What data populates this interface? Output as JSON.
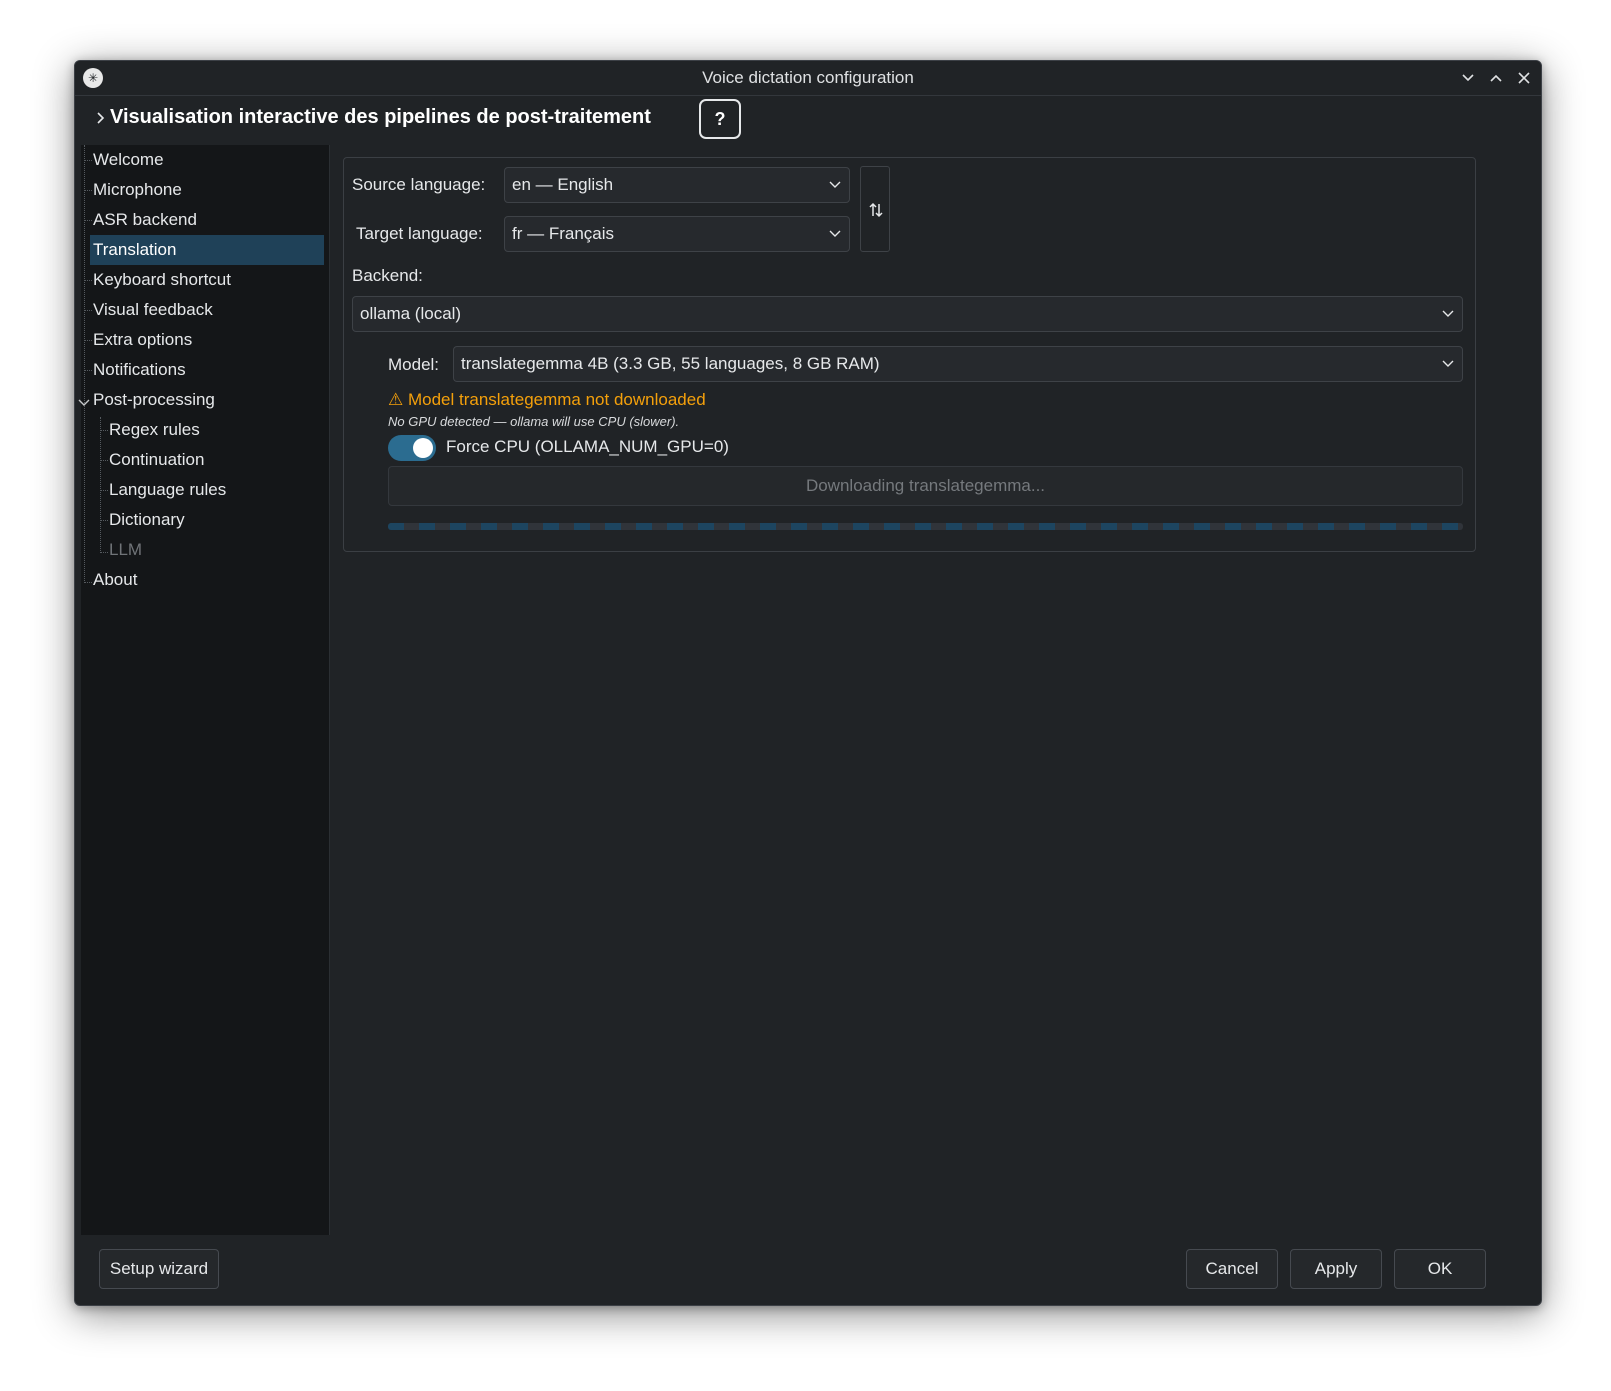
{
  "window": {
    "title": "Voice dictation configuration",
    "app_icon": "waveform-icon",
    "controls": [
      "minimize-icon",
      "maximize-icon",
      "close-icon"
    ]
  },
  "banner": {
    "title": "Visualisation interactive des pipelines de post-traitement",
    "help_label": "?"
  },
  "sidebar": {
    "items": [
      {
        "label": "Welcome"
      },
      {
        "label": "Microphone"
      },
      {
        "label": "ASR backend"
      },
      {
        "label": "Translation",
        "selected": true
      },
      {
        "label": "Keyboard shortcut"
      },
      {
        "label": "Visual feedback"
      },
      {
        "label": "Extra options"
      },
      {
        "label": "Notifications"
      },
      {
        "label": "Post-processing",
        "expanded": true
      },
      {
        "label": "Regex rules"
      },
      {
        "label": "Continuation"
      },
      {
        "label": "Language rules"
      },
      {
        "label": "Dictionary"
      },
      {
        "label": "LLM",
        "disabled": true
      },
      {
        "label": "About"
      }
    ]
  },
  "translation": {
    "source_label": "Source language:",
    "source_value": "en — English",
    "target_label": "Target language:",
    "target_value": "fr — Français",
    "backend_label": "Backend:",
    "backend_value": "ollama (local)",
    "model_label": "Model:",
    "model_value": "translategemma 4B (3.3 GB, 55 languages, 8 GB RAM)",
    "warning": "⚠ Model translategemma not downloaded",
    "note": "No GPU detected — ollama will use CPU (slower).",
    "force_cpu_label": "Force CPU (OLLAMA_NUM_GPU=0)",
    "force_cpu_on": true,
    "download_button": "Downloading translategemma...",
    "progress": "indeterminate"
  },
  "footer": {
    "setup_wizard": "Setup wizard",
    "cancel": "Cancel",
    "apply": "Apply",
    "ok": "OK"
  },
  "colors": {
    "background": "#202326",
    "sidebar": "#141618",
    "selection": "#1f4158",
    "warning": "#f4a00b",
    "toggle": "#2b6c90"
  }
}
